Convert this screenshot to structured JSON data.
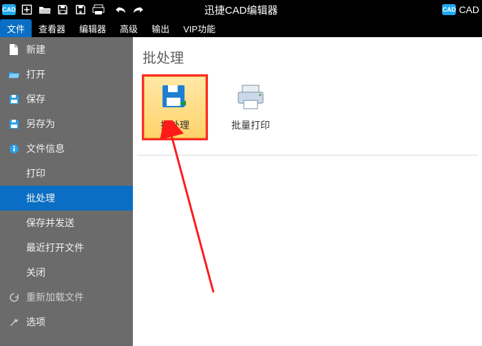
{
  "titlebar": {
    "app_title": "迅捷CAD编辑器",
    "cad_right_label": "CAD"
  },
  "menubar": {
    "items": [
      {
        "label": "文件"
      },
      {
        "label": "查看器"
      },
      {
        "label": "编辑器"
      },
      {
        "label": "高级"
      },
      {
        "label": "输出"
      },
      {
        "label": "VIP功能"
      }
    ]
  },
  "sidebar": {
    "items": [
      {
        "label": "新建"
      },
      {
        "label": "打开"
      },
      {
        "label": "保存"
      },
      {
        "label": "另存为"
      },
      {
        "label": "文件信息"
      },
      {
        "label": "打印"
      },
      {
        "label": "批处理"
      },
      {
        "label": "保存并发送"
      },
      {
        "label": "最近打开文件"
      },
      {
        "label": "关闭"
      },
      {
        "label": "重新加载文件"
      },
      {
        "label": "选项"
      }
    ]
  },
  "content": {
    "header": "批处理",
    "batch_process_label": "批处理",
    "batch_print_label": "批量打印"
  }
}
